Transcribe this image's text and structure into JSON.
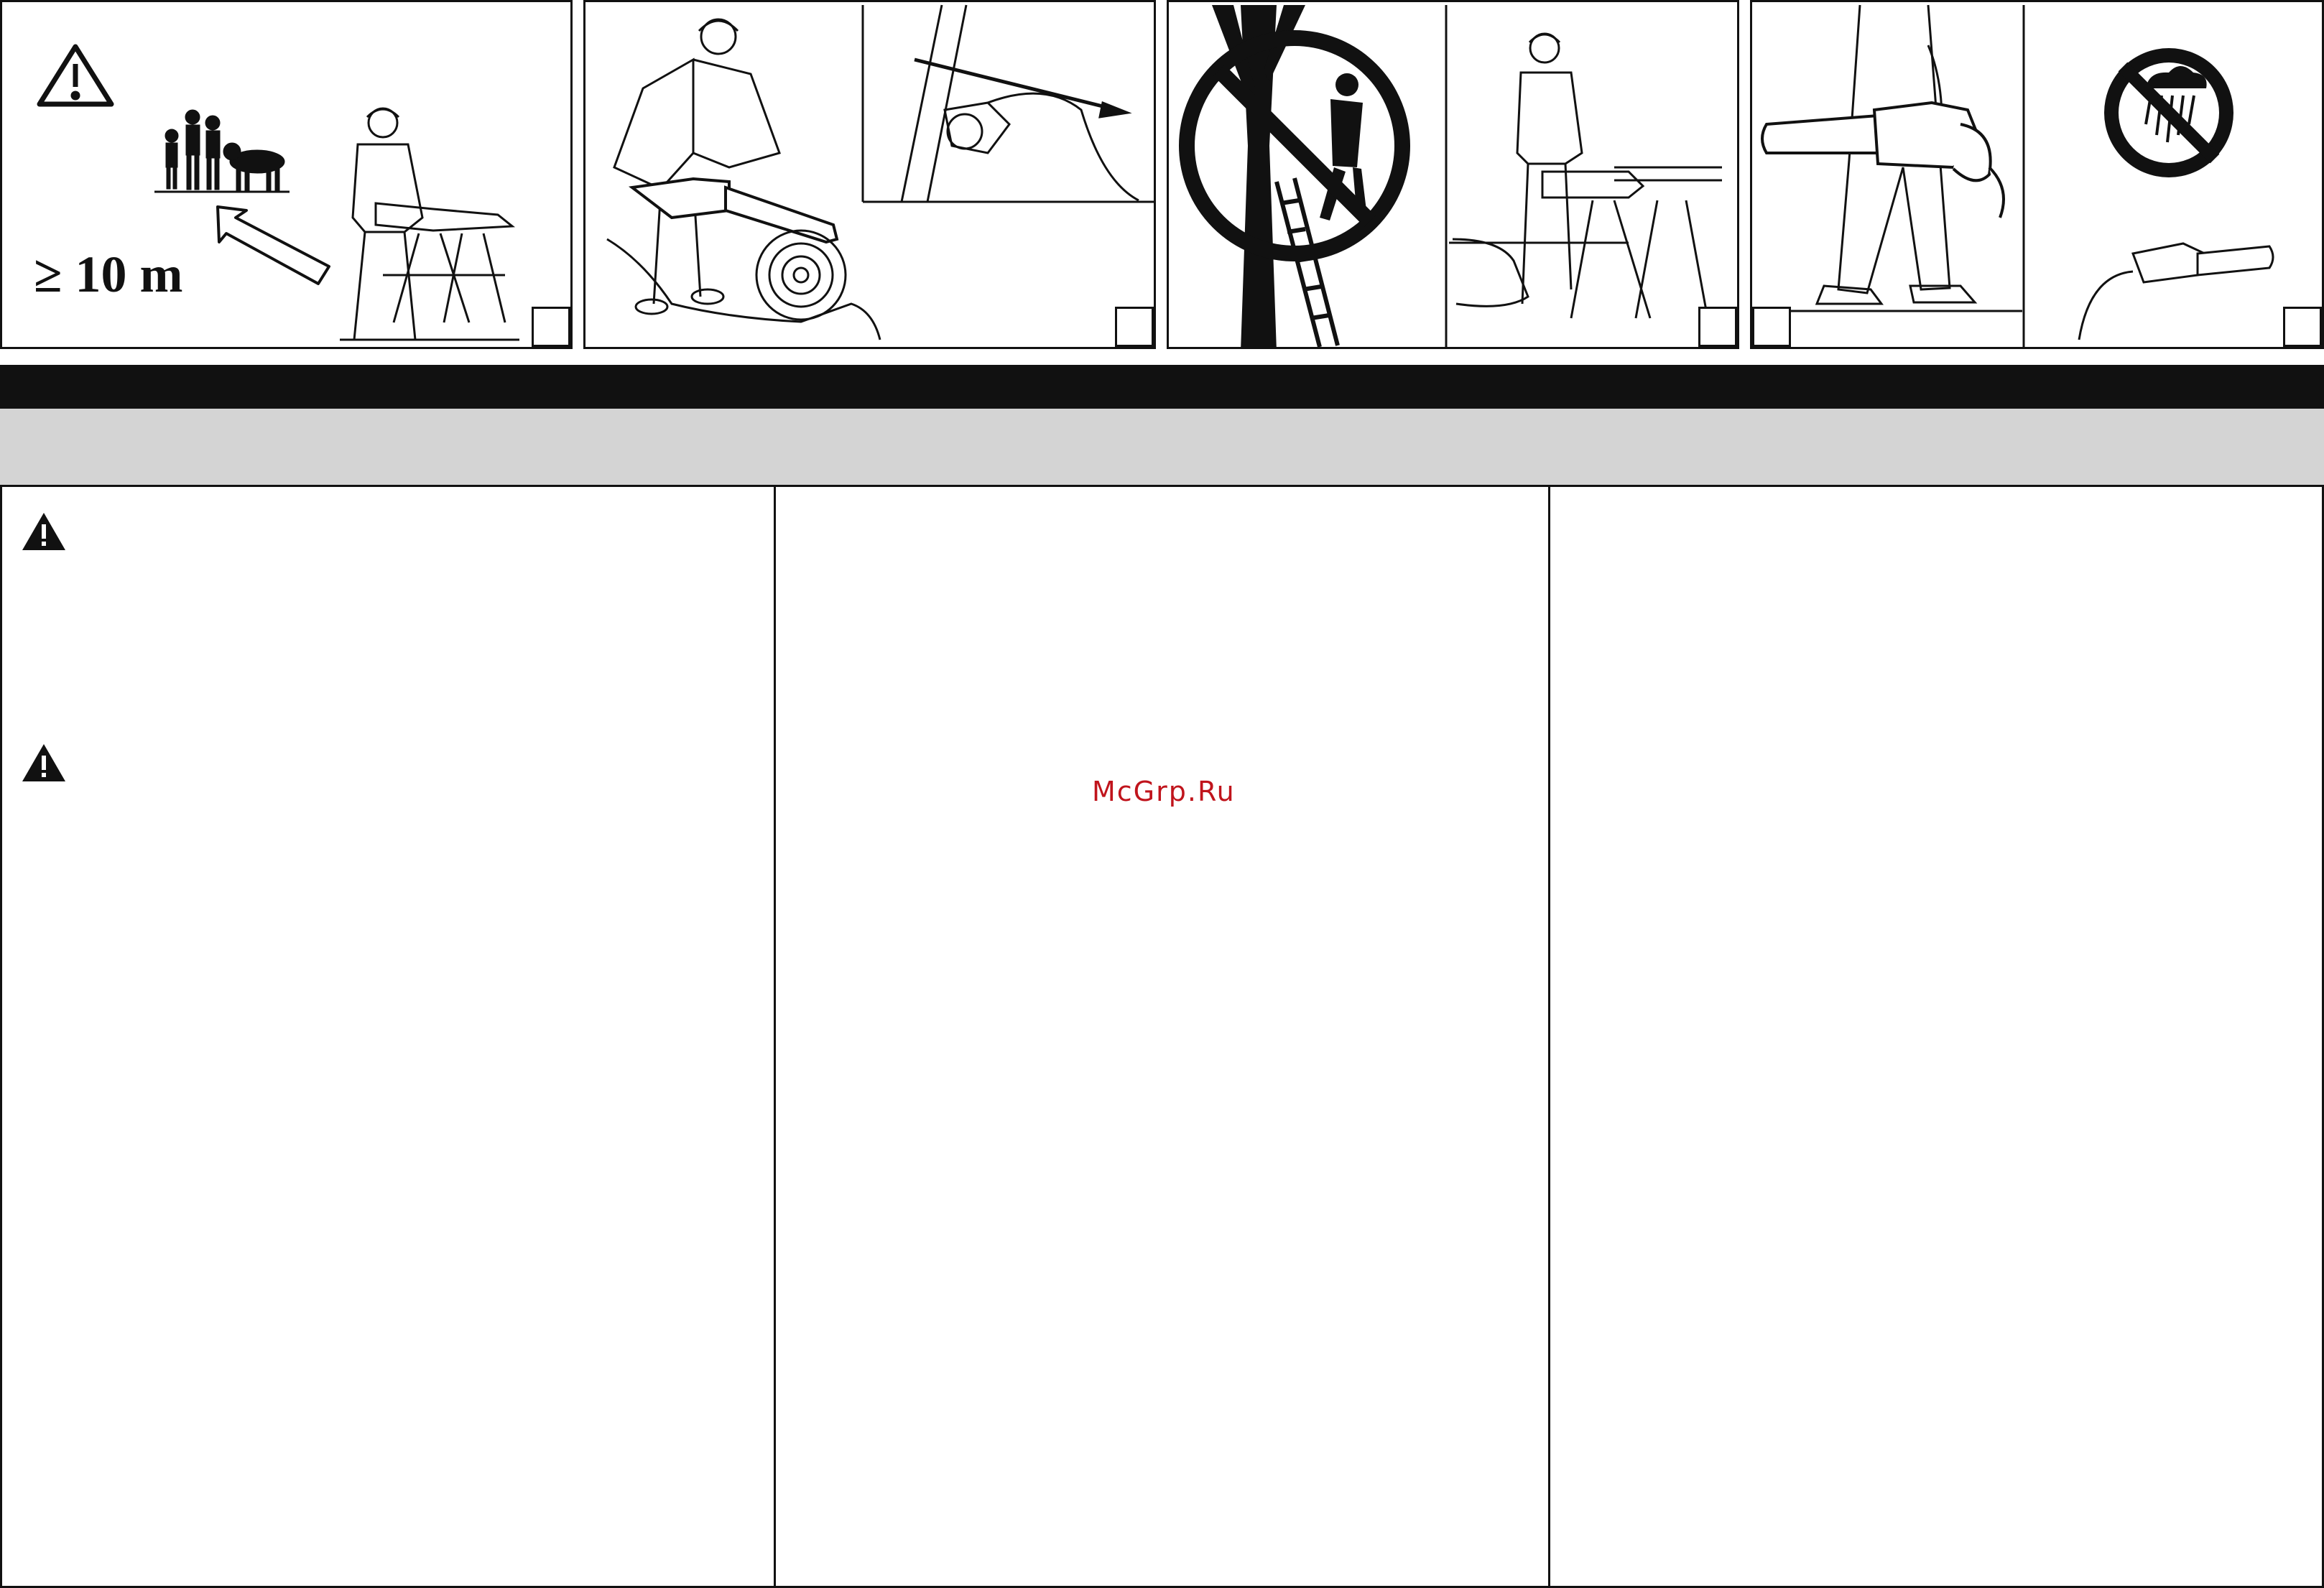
{
  "figures": [
    {
      "label": "",
      "distance_label": "≥ 10 m",
      "icons": [
        "warning-triangle-icon"
      ]
    },
    {
      "label": "",
      "icons": []
    },
    {
      "label": "",
      "icons": [
        "prohibition-icon"
      ]
    },
    {
      "label": "",
      "icons": [
        "no-rain-icon"
      ]
    }
  ],
  "section": {
    "title": "",
    "subtitle": ""
  },
  "columns": [
    {
      "icons": [
        "warning-icon",
        "warning-icon"
      ],
      "text": ""
    },
    {
      "icons": [],
      "text": ""
    },
    {
      "icons": [],
      "text": ""
    }
  ],
  "watermark": "McGrp.Ru",
  "colors": {
    "ink": "#111111",
    "subbar": "#d4d4d4",
    "watermark": "#c0141c"
  }
}
